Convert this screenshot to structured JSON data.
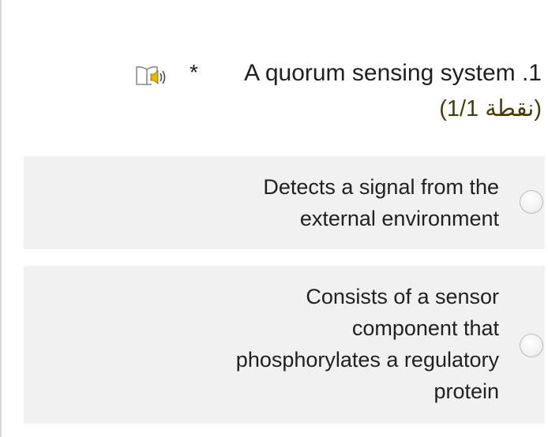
{
  "question": {
    "required_marker": "*",
    "title": "A quorum sensing system .1",
    "points": "(1/1 نقطة)",
    "tts_icon": "book-speaker-icon"
  },
  "options": [
    {
      "lines": [
        "Detects a signal from the",
        "external environment"
      ],
      "selected": false
    },
    {
      "lines": [
        "Consists of a sensor",
        "component that",
        "phosphorylates a regulatory",
        "protein"
      ],
      "selected": false
    }
  ],
  "colors": {
    "option_background": "#f1f1f1",
    "points_text": "#4a3b00",
    "icon_accent": "#e6b800"
  }
}
